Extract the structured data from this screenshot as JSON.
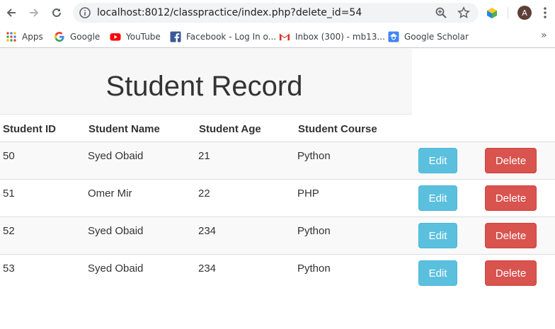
{
  "browser": {
    "url": "localhost:8012/classpractice/index.php?delete_id=54",
    "avatar_letter": "A",
    "bookmarks": [
      {
        "label": "Apps",
        "icon": "apps-grid-icon"
      },
      {
        "label": "Google",
        "icon": "google-icon"
      },
      {
        "label": "YouTube",
        "icon": "youtube-icon"
      },
      {
        "label": "Facebook - Log In o...",
        "icon": "facebook-icon"
      },
      {
        "label": "Inbox (300) - mb13...",
        "icon": "gmail-icon"
      },
      {
        "label": "Google Scholar",
        "icon": "google-scholar-icon"
      }
    ],
    "more_label": "»"
  },
  "page": {
    "title": "Student Record",
    "columns": [
      "Student ID",
      "Student Name",
      "Student Age",
      "Student Course"
    ],
    "edit_label": "Edit",
    "delete_label": "Delete",
    "rows": [
      {
        "id": "50",
        "name": "Syed Obaid",
        "age": "21",
        "course": "Python"
      },
      {
        "id": "51",
        "name": "Omer Mir",
        "age": "22",
        "course": "PHP"
      },
      {
        "id": "52",
        "name": "Syed Obaid",
        "age": "234",
        "course": "Python"
      },
      {
        "id": "53",
        "name": "Syed Obaid",
        "age": "234",
        "course": "Python"
      }
    ]
  },
  "colors": {
    "edit_button": "#5bc0de",
    "delete_button": "#d9534f",
    "jumbotron": "#f7f7f7",
    "striped_row": "#f9f9f9"
  }
}
